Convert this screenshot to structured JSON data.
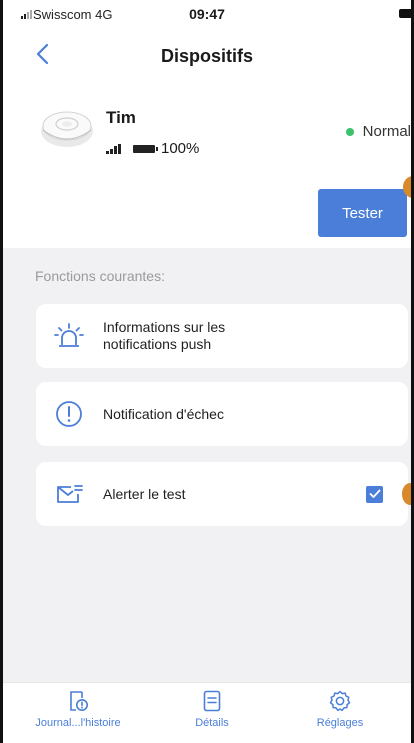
{
  "status_bar": {
    "carrier": "Swisscom 4G",
    "time": "09:47"
  },
  "header": {
    "title": "Dispositifs",
    "back_icon": "chevron-left-icon"
  },
  "device": {
    "name": "Tim",
    "battery_percent_label": "100%",
    "battery_level": 1.0,
    "status": "Normal",
    "status_color": "#3cc06b"
  },
  "actions": {
    "test_label": "Tester"
  },
  "functions": {
    "section_label": "Fonctions courantes:",
    "items": [
      {
        "label": "Informations sur les notifications push",
        "icon": "siren-icon"
      },
      {
        "label": "Notification d'échec",
        "icon": "alert-circle-icon"
      },
      {
        "label": "Alerter le test",
        "icon": "mail-alert-icon",
        "checked": true
      }
    ]
  },
  "tabs": [
    {
      "label": "Journal...l'histoire",
      "icon": "history-doc-icon"
    },
    {
      "label": "Détails",
      "icon": "document-icon"
    },
    {
      "label": "Réglages",
      "icon": "gear-icon"
    }
  ],
  "colors": {
    "accent": "#4a7ed8",
    "background": "#f1f1f3"
  }
}
